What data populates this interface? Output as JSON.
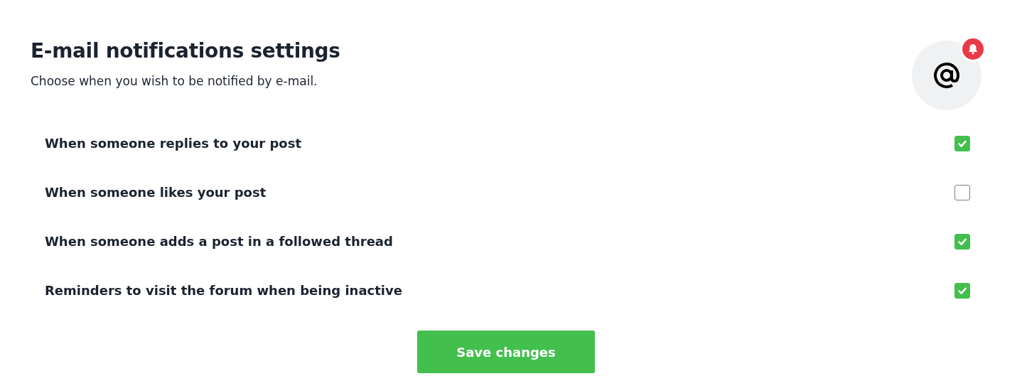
{
  "title": "E-mail notifications settings",
  "subtitle": "Choose when you wish to be notified by e-mail.",
  "options": [
    {
      "label": "When someone replies to your post",
      "checked": true
    },
    {
      "label": "When someone likes your post",
      "checked": false
    },
    {
      "label": "When someone adds a post in a followed thread",
      "checked": true
    },
    {
      "label": "Reminders to visit the forum when being inactive",
      "checked": true
    }
  ],
  "save_button": "Save changes"
}
